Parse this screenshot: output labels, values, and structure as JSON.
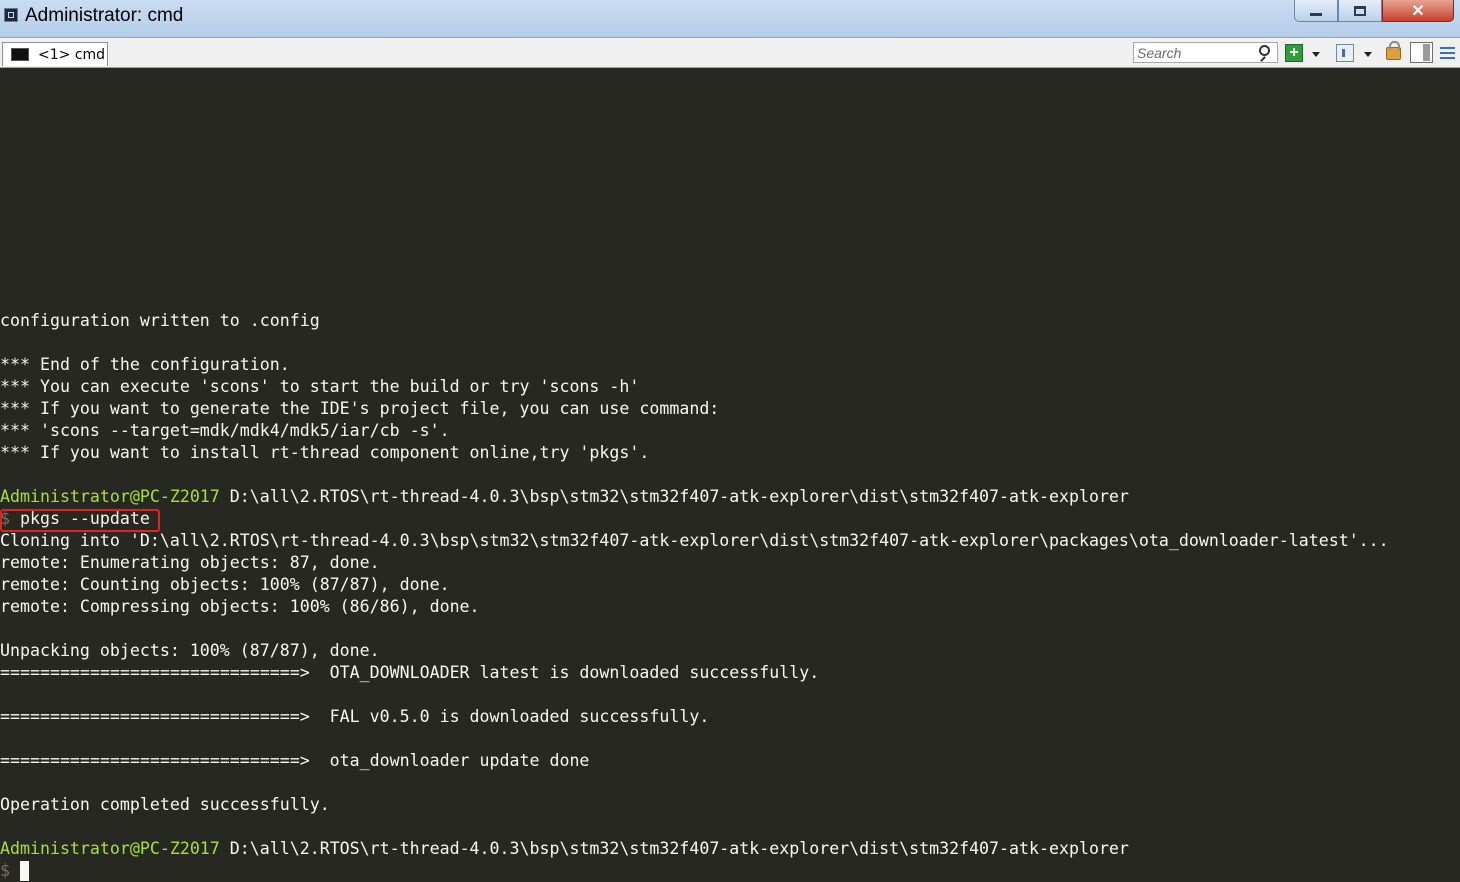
{
  "window": {
    "title": "Administrator: cmd",
    "minimize_icon": "minimize-icon",
    "maximize_icon": "maximize-icon",
    "close_icon": "close-icon",
    "close_glyph": "✕"
  },
  "toolbar": {
    "tab_label": "<1> cmd",
    "search_placeholder": "Search",
    "new_console_glyph": "+"
  },
  "console": {
    "lines": [
      "configuration written to .config",
      "",
      "*** End of the configuration.",
      "*** You can execute 'scons' to start the build or try 'scons -h'",
      "*** If you want to generate the IDE's project file, you can use command:",
      "*** 'scons --target=mdk/mdk4/mdk5/iar/cb -s'.",
      "*** If you want to install rt-thread component online,try 'pkgs'.",
      "",
      "",
      "",
      "Cloning into 'D:\\all\\2.RTOS\\rt-thread-4.0.3\\bsp\\stm32\\stm32f407-atk-explorer\\dist\\stm32f407-atk-explorer\\packages\\ota_downloader-latest'...",
      "remote: Enumerating objects: 87, done.",
      "remote: Counting objects: 100% (87/87), done.",
      "remote: Compressing objects: 100% (86/86), done.",
      "",
      "Unpacking objects: 100% (87/87), done.",
      "==============================>  OTA_DOWNLOADER latest is downloaded successfully.",
      "",
      "==============================>  FAL v0.5.0 is downloaded successfully.",
      "",
      "==============================>  ota_downloader update done",
      "",
      "Operation completed successfully."
    ],
    "prompt1": {
      "user": "Administrator@PC-Z2017",
      "path": " D:\\all\\2.RTOS\\rt-thread-4.0.3\\bsp\\stm32\\stm32f407-atk-explorer\\dist\\stm32f407-atk-explorer"
    },
    "command_prefix": "$ ",
    "command": "pkgs --update",
    "prompt2": {
      "user": "Administrator@PC-Z2017",
      "path": " D:\\all\\2.RTOS\\rt-thread-4.0.3\\bsp\\stm32\\stm32f407-atk-explorer\\dist\\stm32f407-atk-explorer"
    },
    "final_prompt": "$ "
  },
  "colors": {
    "background": "#272822",
    "text": "#f8f8f2",
    "prompt_green": "#a6e22e",
    "highlight_red": "#e0231c"
  }
}
